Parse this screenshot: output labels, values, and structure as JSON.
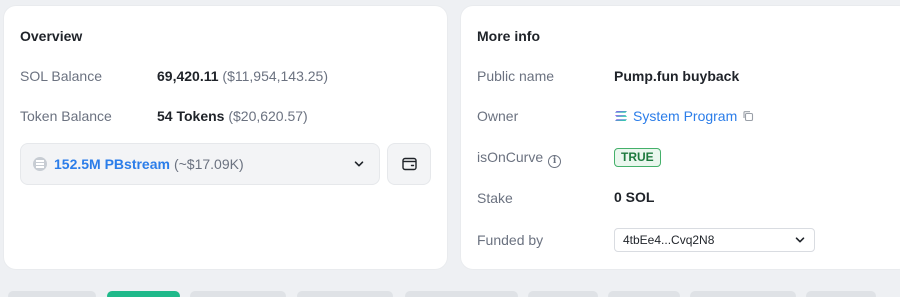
{
  "overview": {
    "title": "Overview",
    "sol_balance_label": "SOL Balance",
    "sol_balance_value": "69,420.11",
    "sol_balance_usd": "($11,954,143.25)",
    "token_balance_label": "Token Balance",
    "token_balance_value": "54 Tokens",
    "token_balance_usd": "($20,620.57)",
    "token_select_amount": "152.5M PBstream",
    "token_select_usd": "(~$17.09K)"
  },
  "more_info": {
    "title": "More info",
    "public_name_label": "Public name",
    "public_name_value": "Pump.fun buyback",
    "owner_label": "Owner",
    "owner_value": "System Program",
    "is_on_curve_label": "isOnCurve",
    "is_on_curve_value": "TRUE",
    "stake_label": "Stake",
    "stake_value": "0 SOL",
    "funded_by_label": "Funded by",
    "funded_by_value": "4tbEe4...Cvq2N8"
  },
  "colors": {
    "link": "#2b7de9",
    "badge_green": "#44b06a",
    "badge_bg": "#eaf7ee",
    "card_bg": "#ffffff",
    "page_bg": "#eef0f3"
  }
}
